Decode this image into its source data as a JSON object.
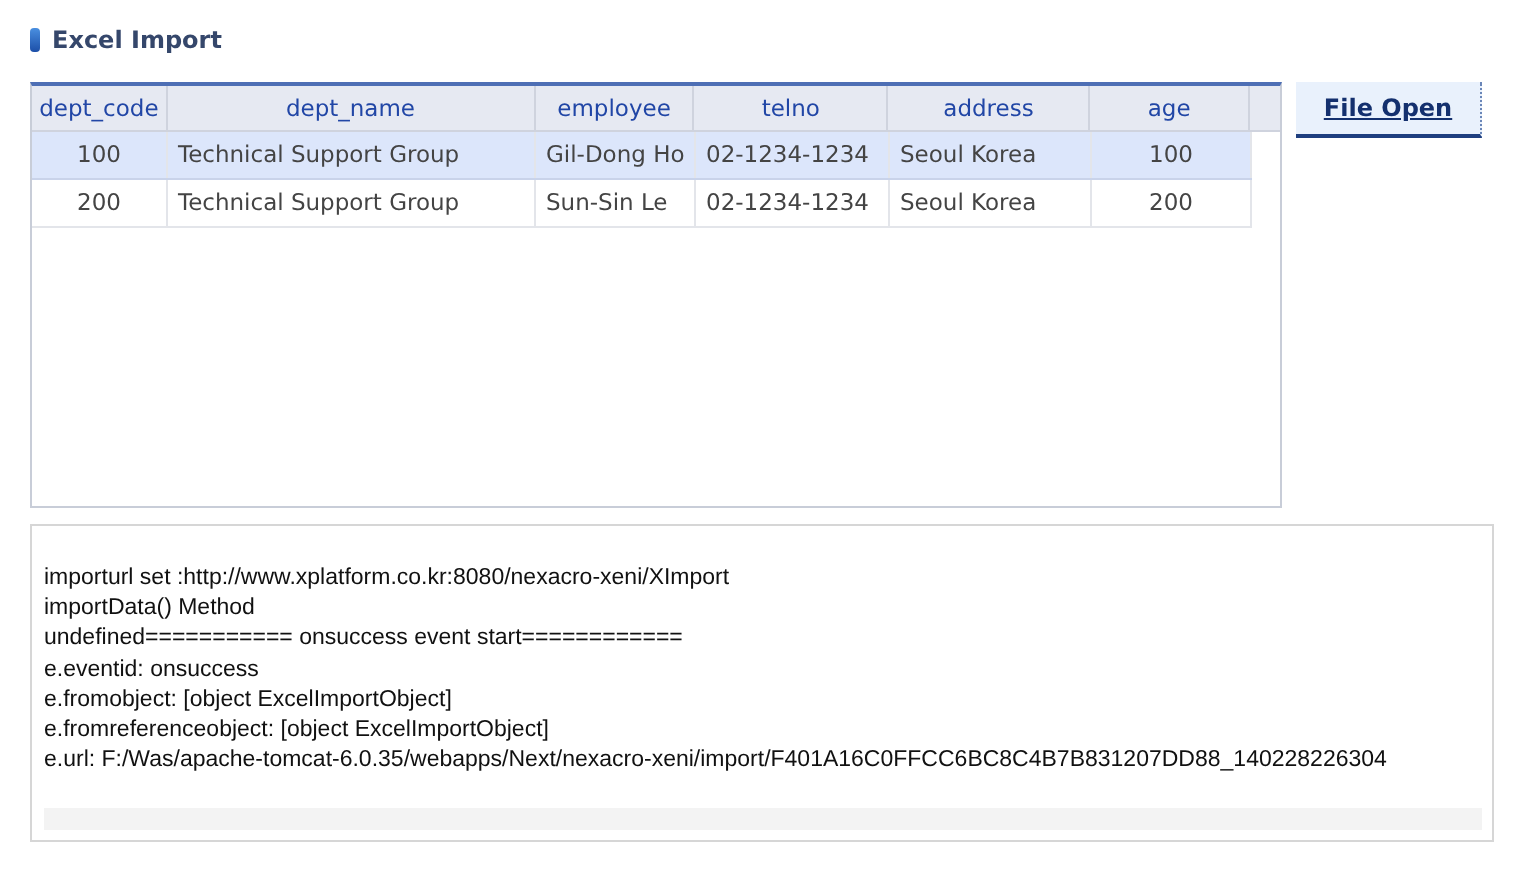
{
  "title": "Excel Import",
  "table": {
    "columns": [
      "dept_code",
      "dept_name",
      "employee",
      "telno",
      "address",
      "age"
    ],
    "rows": [
      {
        "selected": true,
        "cells": [
          "100",
          "Technical Support Group",
          "Gil-Dong Ho",
          "02-1234-1234",
          "Seoul Korea",
          "100"
        ]
      },
      {
        "selected": false,
        "cells": [
          "200",
          "Technical Support Group",
          "Sun-Sin Le",
          "02-1234-1234",
          "Seoul Korea",
          "200"
        ]
      }
    ]
  },
  "file_open_button": "File Open",
  "log": [
    "importurl set :http://www.xplatform.co.kr:8080/nexacro-xeni/XImport",
    "importData() Method",
    "undefined=========== onsuccess event start============",
    "e.eventid: onsuccess",
    "e.fromobject: [object ExcelImportObject]",
    "e.fromreferenceobject: [object ExcelImportObject]",
    "e.url: F:/Was/apache-tomcat-6.0.35/webapps/Next/nexacro-xeni/import/F401A16C0FFCC6BC8C4B7B831207DD88_140228226304"
  ]
}
